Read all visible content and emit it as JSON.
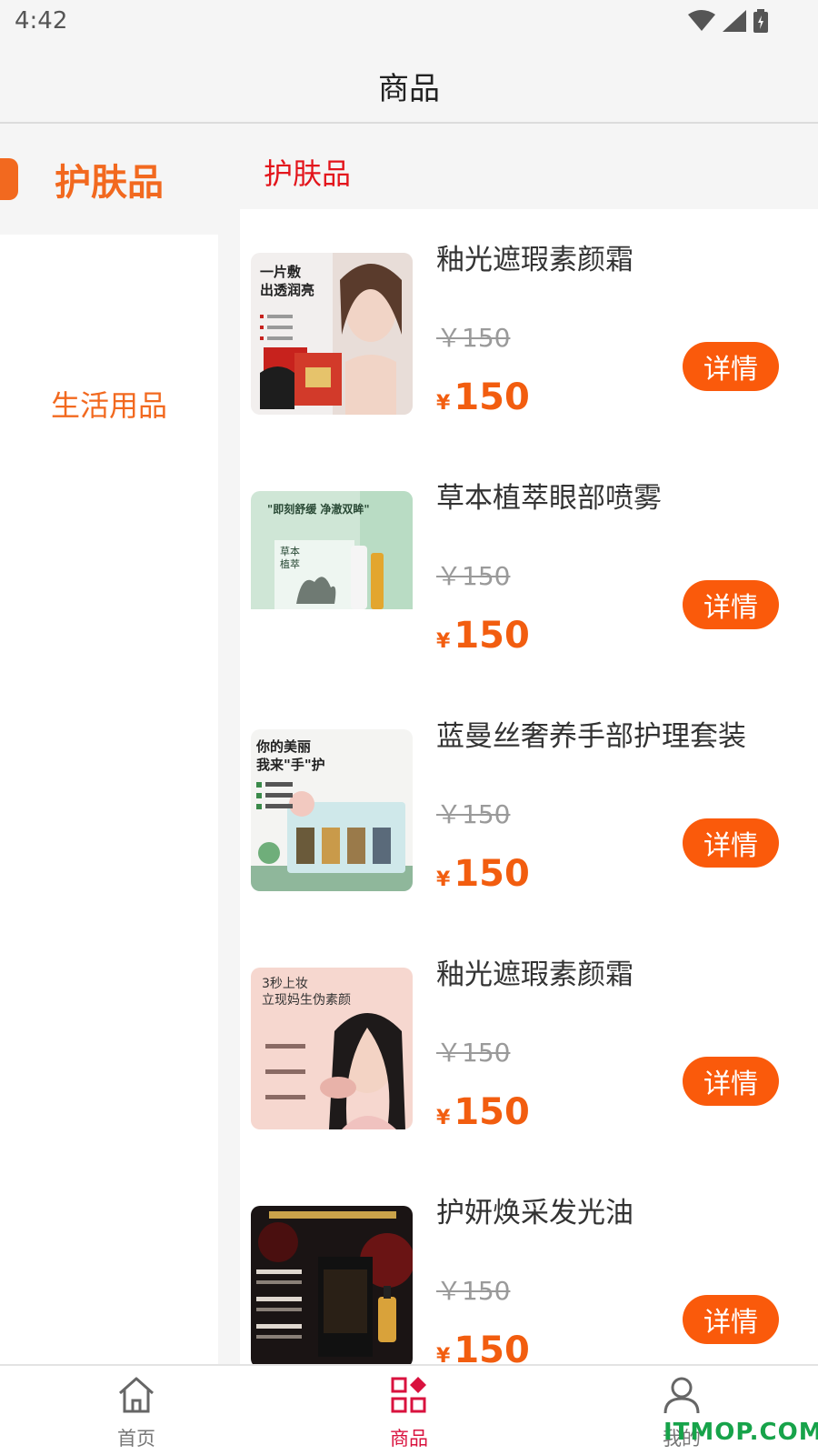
{
  "status_bar": {
    "time": "4:42",
    "icons": [
      "wifi-icon",
      "signal-icon",
      "battery-icon"
    ]
  },
  "header": {
    "title": "商品"
  },
  "sidebar": {
    "items": [
      {
        "label": "护肤品",
        "active": true
      },
      {
        "label": "生活用品",
        "active": false
      }
    ]
  },
  "main": {
    "category_title": "护肤品",
    "products": [
      {
        "name": "釉光遮瑕素颜霜",
        "original_price": "￥150",
        "currency": "¥",
        "price": "150",
        "button": "详情",
        "image_text": [
          "一片敷",
          "出透润亮"
        ]
      },
      {
        "name": "草本植萃眼部喷雾",
        "original_price": "￥150",
        "currency": "¥",
        "price": "150",
        "button": "详情",
        "image_text": [
          "\"即刻舒缓 净澈双眸\"",
          "草本",
          "植萃"
        ]
      },
      {
        "name": "蓝曼丝奢养手部护理套装",
        "original_price": "￥150",
        "currency": "¥",
        "price": "150",
        "button": "详情",
        "image_text": [
          "你的美丽",
          "我来\"手\"护"
        ]
      },
      {
        "name": "釉光遮瑕素颜霜",
        "original_price": "￥150",
        "currency": "¥",
        "price": "150",
        "button": "详情",
        "image_text": [
          "3秒上妆",
          "立现妈生伪素颜"
        ]
      },
      {
        "name": "护妍焕采发光油",
        "original_price": "￥150",
        "currency": "¥",
        "price": "150",
        "button": "详情",
        "image_text": []
      }
    ]
  },
  "tab_bar": {
    "tabs": [
      {
        "label": "首页",
        "icon": "home-icon",
        "active": false
      },
      {
        "label": "商品",
        "icon": "grid-icon",
        "active": true
      },
      {
        "label": "我的",
        "icon": "user-icon",
        "active": false
      }
    ]
  },
  "watermark": "ITMOP.COM",
  "colors": {
    "accent": "#f2691f",
    "button": "#fa5a0b",
    "active_tab": "#d9123e",
    "category_title": "#e3151c"
  }
}
